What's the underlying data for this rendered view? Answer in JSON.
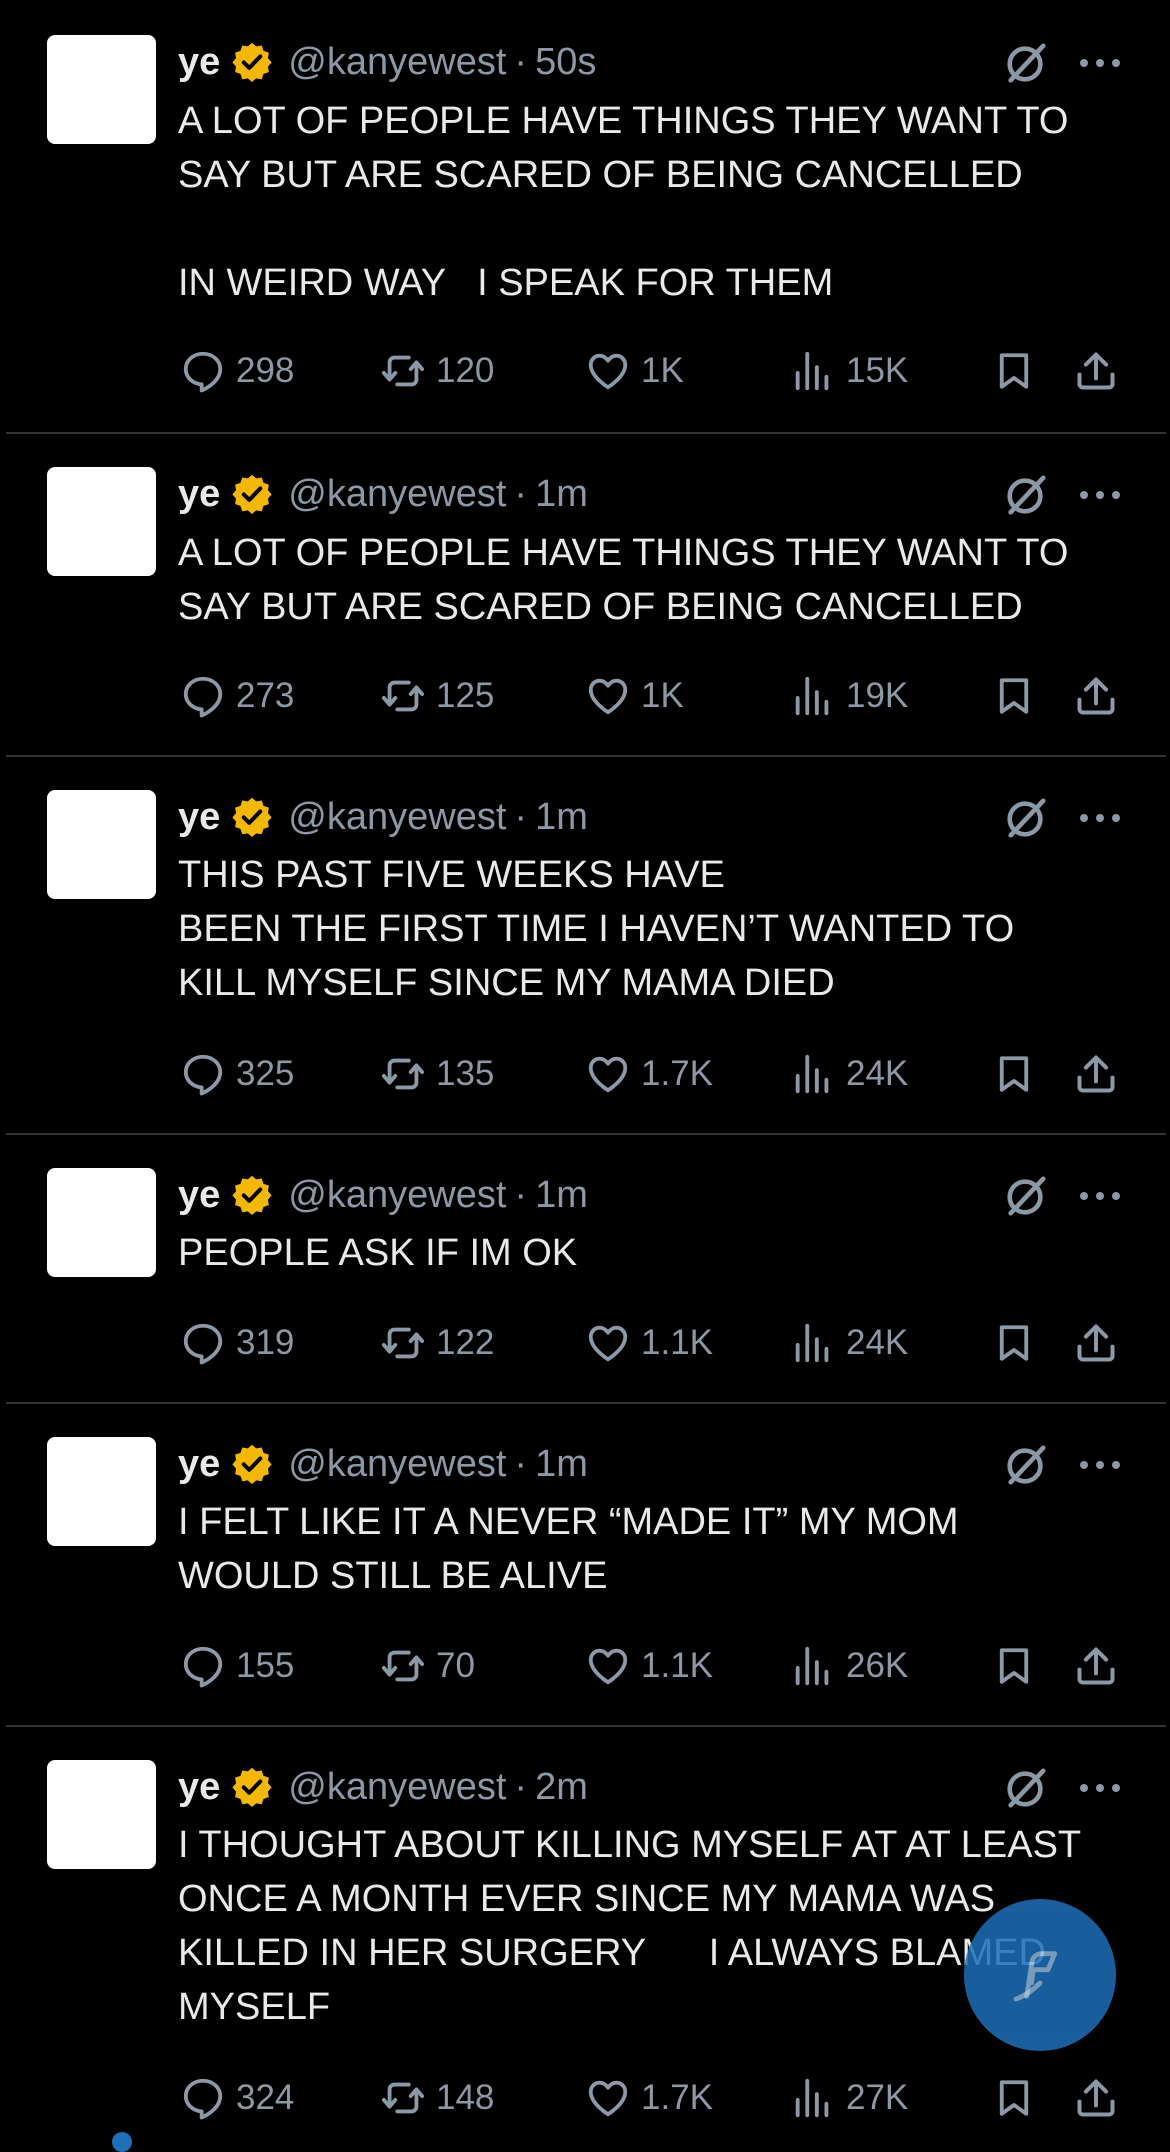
{
  "accent_color": "#1d9bf0",
  "verified_color": "#f5b800",
  "tweets": [
    {
      "name": "ye",
      "handle": "@kanyewest",
      "separator": "·",
      "time": "50s",
      "text": "A LOT OF PEOPLE HAVE THINGS THEY WANT TO\nSAY BUT ARE SCARED OF BEING CANCELLED\n\nIN WEIRD WAY   I SPEAK FOR THEM",
      "replies": "298",
      "reposts": "120",
      "likes": "1K",
      "views": "15K"
    },
    {
      "name": "ye",
      "handle": "@kanyewest",
      "separator": "·",
      "time": "1m",
      "text": "A LOT OF PEOPLE HAVE THINGS THEY WANT TO\nSAY BUT ARE SCARED OF BEING CANCELLED",
      "replies": "273",
      "reposts": "125",
      "likes": "1K",
      "views": "19K"
    },
    {
      "name": "ye",
      "handle": "@kanyewest",
      "separator": "·",
      "time": "1m",
      "text": "THIS PAST FIVE WEEKS HAVE\nBEEN THE FIRST TIME I HAVEN’T WANTED TO\nKILL MYSELF SINCE MY MAMA DIED",
      "replies": "325",
      "reposts": "135",
      "likes": "1.7K",
      "views": "24K"
    },
    {
      "name": "ye",
      "handle": "@kanyewest",
      "separator": "·",
      "time": "1m",
      "text": "PEOPLE ASK IF IM OK",
      "replies": "319",
      "reposts": "122",
      "likes": "1.1K",
      "views": "24K"
    },
    {
      "name": "ye",
      "handle": "@kanyewest",
      "separator": "·",
      "time": "1m",
      "text": "I FELT LIKE IT A NEVER “MADE IT” MY MOM\nWOULD STILL BE ALIVE",
      "replies": "155",
      "reposts": "70",
      "likes": "1.1K",
      "views": "26K"
    },
    {
      "name": "ye",
      "handle": "@kanyewest",
      "separator": "·",
      "time": "2m",
      "text": "I THOUGHT ABOUT KILLING MYSELF AT AT LEAST\nONCE A MONTH EVER SINCE MY MAMA WAS\nKILLED IN HER SURGERY      I ALWAYS BLAMED\nMYSELF",
      "replies": "324",
      "reposts": "148",
      "likes": "1.7K",
      "views": "27K"
    }
  ]
}
